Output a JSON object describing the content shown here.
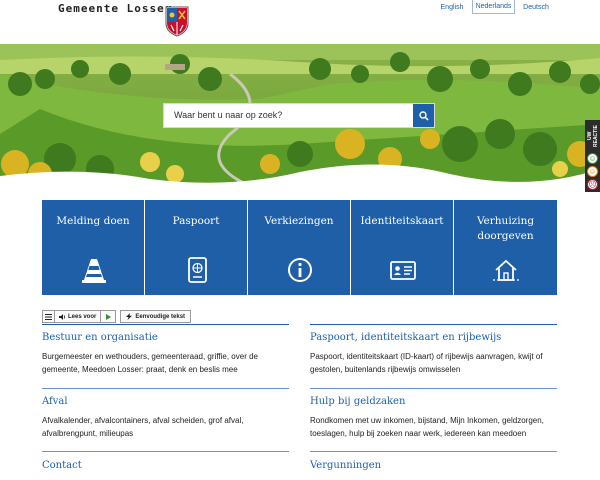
{
  "header": {
    "logo_text": "Gemeente Losser",
    "languages": [
      {
        "label": "English",
        "active": false
      },
      {
        "label": "Nederlands",
        "active": true
      },
      {
        "label": "Deutsch",
        "active": false
      }
    ]
  },
  "search": {
    "placeholder": "Waar bent u naar op zoek?",
    "button_icon": "search-icon"
  },
  "feedback": {
    "label": "UW REACTIE",
    "faces": [
      "happy-face-icon",
      "neutral-face-icon",
      "sad-face-icon"
    ]
  },
  "tiles": [
    {
      "label": "Melding doen",
      "icon": "traffic-cone-icon"
    },
    {
      "label": "Paspoort",
      "icon": "passport-icon"
    },
    {
      "label": "Verkiezingen",
      "icon": "info-icon"
    },
    {
      "label": "Identiteitskaart",
      "icon": "id-card-icon"
    },
    {
      "label": "Verhuizing doorgeven",
      "icon": "house-move-icon"
    }
  ],
  "readspeaker": {
    "listen_label": "Lees voor",
    "simple_text_label": "Eenvoudige tekst"
  },
  "categories": [
    {
      "title": "Bestuur en organisatie",
      "description": "Burgemeester en wethouders, gemeenteraad, griffie, over de gemeente, Meedoen Losser: praat, denk en beslis mee"
    },
    {
      "title": "Paspoort, identiteitskaart en rijbewijs",
      "description": "Paspoort, identiteitskaart (ID-kaart) of rijbewijs aanvragen, kwijt of gestolen, buitenlands rijbewijs omwisselen"
    },
    {
      "title": "Afval",
      "description": "Afvalkalender, afvalcontainers, afval scheiden, grof afval, afvalbrengpunt, milieupas"
    },
    {
      "title": "Hulp bij geldzaken",
      "description": "Rondkomen met uw inkomen, bijstand, Mijn Inkomen, geldzorgen, toeslagen, hulp bij zoeken naar werk, iedereen kan meedoen"
    },
    {
      "title": "Contact",
      "description": ""
    },
    {
      "title": "Vergunningen",
      "description": ""
    }
  ],
  "colors": {
    "primary_blue": "#1f5fa8",
    "divider_blue": "#6d95c6",
    "background": "#ffffff"
  }
}
